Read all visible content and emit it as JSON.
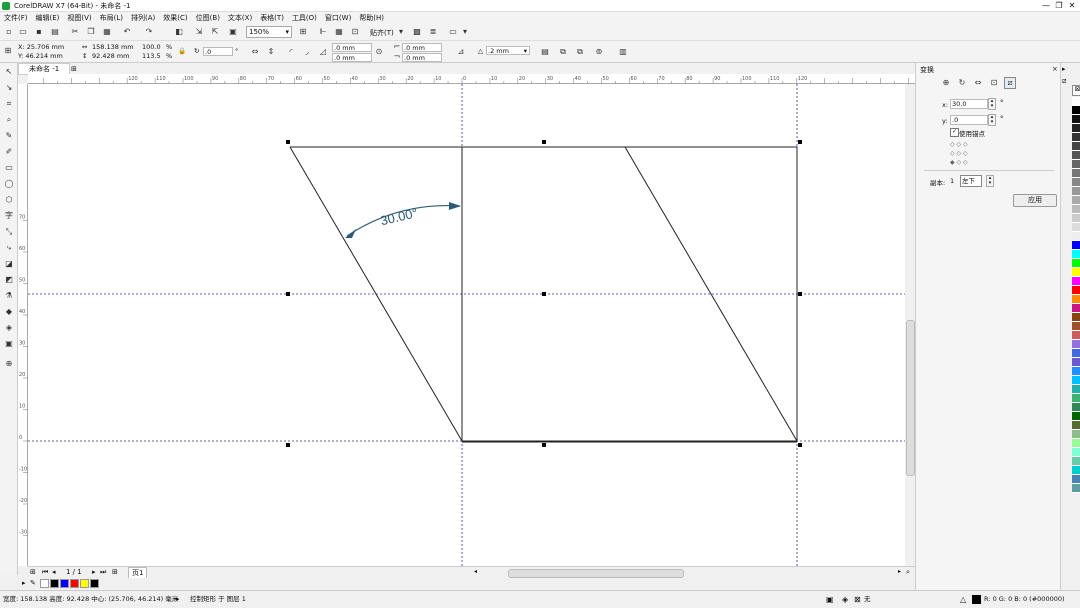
{
  "window": {
    "title": "CorelDRAW X7 (64-Bit) - 未命名 -1",
    "minimize": "—",
    "maximize": "❐",
    "close": "✕"
  },
  "menu": [
    "文件(F)",
    "编辑(E)",
    "视图(V)",
    "布局(L)",
    "排列(A)",
    "效果(C)",
    "位图(B)",
    "文本(X)",
    "表格(T)",
    "工具(O)",
    "窗口(W)",
    "帮助(H)"
  ],
  "toolbar": {
    "zoom": "150%",
    "snap_label": "贴齐(T)"
  },
  "propbar": {
    "x": "X: 25.706 mm",
    "y": "Y: 46.214 mm",
    "width": "158.138 mm",
    "height": "92.428 mm",
    "scale_w": "100.0",
    "scale_h": "113.5",
    "pct": "%",
    "rotation": ".0",
    "nudge_x": ".0 mm",
    "nudge_y": ".0 mm",
    "dup_x": ".0 mm",
    "dup_y": ".0 mm",
    "outline": ".2 mm"
  },
  "document": {
    "tab_label": "未命名 -1"
  },
  "ruler": {
    "h_ticks": [
      "120",
      "110",
      "100",
      "90",
      "80",
      "70",
      "60",
      "50",
      "40",
      "30",
      "20",
      "10",
      "0",
      "10",
      "20",
      "30",
      "40",
      "50",
      "60",
      "70",
      "80",
      "90",
      "100",
      "110",
      "120"
    ],
    "v_ticks": [
      "70",
      "60",
      "50",
      "40",
      "30",
      "20",
      "10",
      "0",
      "-10",
      "-20",
      "-30",
      "-40",
      "-50",
      "-60",
      "-70"
    ]
  },
  "canvas": {
    "angle_label": "30.00°"
  },
  "pager": {
    "page_count": "1 / 1",
    "page_tab": "页1"
  },
  "dock": {
    "panel_title": "变换",
    "x_label": "x:",
    "x_value": "30.0",
    "y_label": "y:",
    "y_value": ".0",
    "degree": "°",
    "use_anchor": "使用锚点",
    "copies_label": "副本:",
    "copies_value": "1",
    "anchor_select": "左下",
    "apply_button": "应用"
  },
  "status": {
    "size": "宽度: 158.138  高度: 92.428  中心: (25.706, 46.214)  毫米",
    "layer": "控制矩形 于 图层 1",
    "fill": "无",
    "color": "R: 0 G: 0 B: 0 (#000000)"
  },
  "colors": {
    "guide": "#2b2ba8",
    "arrow": "#2e5a7a",
    "accent": "#1f9d3a"
  },
  "palette_colors": [
    "#ffffff",
    "#000000",
    "#111111",
    "#222222",
    "#333333",
    "#444444",
    "#555555",
    "#666666",
    "#777777",
    "#888888",
    "#999999",
    "#aaaaaa",
    "#bbbbbb",
    "#cccccc",
    "#dddddd",
    "#eeeeee",
    "#0000ff",
    "#00ffff",
    "#00ff00",
    "#ffff00",
    "#ff00ff",
    "#ff0000",
    "#ff8c00",
    "#c71585",
    "#8b4513",
    "#a0522d",
    "#cd5c5c",
    "#9370db",
    "#4169e1",
    "#6a5acd",
    "#1e90ff",
    "#00bfff",
    "#20b2aa",
    "#3cb371",
    "#2e8b57",
    "#006400",
    "#556b2f",
    "#8fbc8f",
    "#98fb98",
    "#7fffd4",
    "#66cdaa",
    "#00ced1",
    "#4682b4",
    "#5f9ea0"
  ],
  "doc_palette": [
    "#ffffff",
    "#000000",
    "#0000ff",
    "#ff0000",
    "#ffff00",
    "#000000"
  ]
}
